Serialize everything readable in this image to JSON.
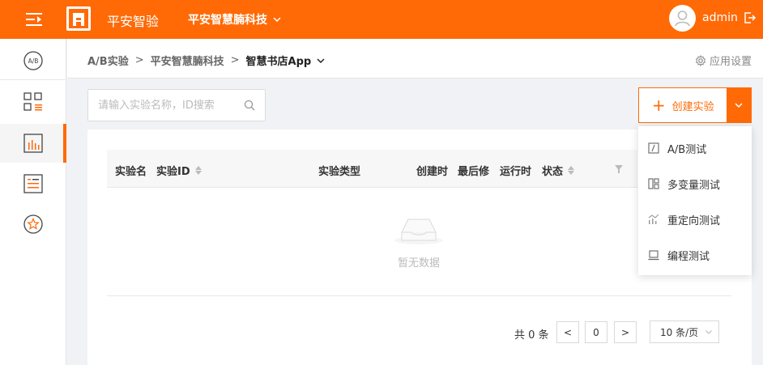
{
  "colors": {
    "brand": "#ff6a06",
    "sidebar_active_bg": "#f5f5f5"
  },
  "header": {
    "brand": "平安智验",
    "org": "平安智慧腩科技",
    "username": "admin"
  },
  "sidebar": {
    "items": [
      {
        "icon": "ab-test-icon",
        "label": "A/B"
      },
      {
        "icon": "grid-list-icon"
      },
      {
        "icon": "bar-chart-icon",
        "active": true
      },
      {
        "icon": "document-list-icon"
      },
      {
        "icon": "star-icon"
      }
    ]
  },
  "breadcrumb": {
    "items": [
      "A/B实验",
      "平安智慧腩科技",
      "智慧书店App"
    ],
    "separator": ">"
  },
  "app_settings": "应用设置",
  "search": {
    "placeholder": "请输入实验名称，ID搜索",
    "value": ""
  },
  "create_button": {
    "plus": "+",
    "label": "创建实验"
  },
  "table": {
    "columns": [
      "实验名",
      "实验ID",
      "实验类型",
      "创建时",
      "最后修",
      "运行时",
      "状态"
    ],
    "empty_text": "暂无数据"
  },
  "pagination": {
    "total": "共 0 条",
    "prev": "<",
    "current_page": "0",
    "next": ">",
    "page_size": "10 条/页"
  },
  "create_menu": {
    "items": [
      {
        "icon": "ab-test-icon",
        "label": "A/B测试"
      },
      {
        "icon": "multivariate-icon",
        "label": "多变量测试"
      },
      {
        "icon": "redirect-icon",
        "label": "重定向测试"
      },
      {
        "icon": "laptop-code-icon",
        "label": "编程测试"
      }
    ]
  }
}
